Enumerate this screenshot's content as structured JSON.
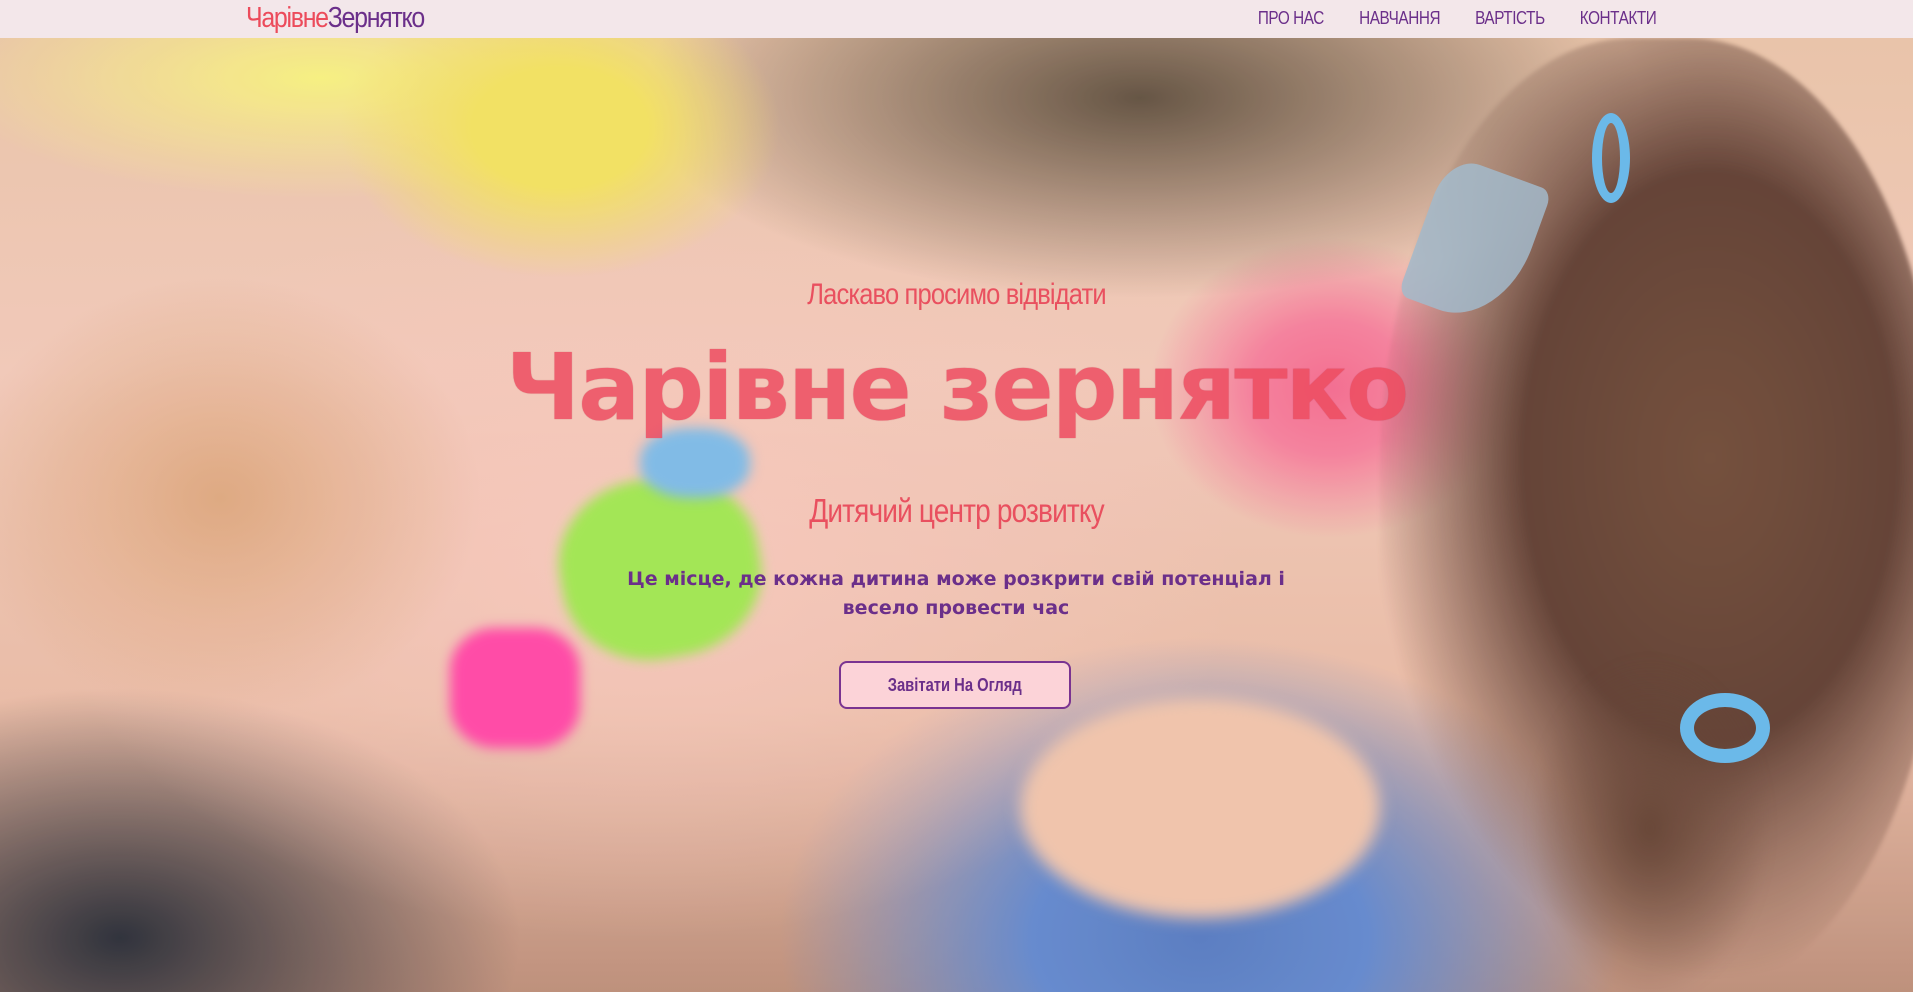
{
  "brand": {
    "part1": "Чарівне",
    "part2": "Зернятко"
  },
  "nav": {
    "items": [
      {
        "label": "ПРО НАС"
      },
      {
        "label": "НАВЧАННЯ"
      },
      {
        "label": "ВАРТІСТЬ"
      },
      {
        "label": "КОНТАКТИ"
      }
    ]
  },
  "hero": {
    "welcome": "Ласкаво просимо відвідати",
    "title": "Чарівне зернятко",
    "subtitle": "Дитячий центр розвитку",
    "description": "Це місце, де кожна дитина може розкрити свій потенціал і весело провести час",
    "cta_label": "Завітати На Огляд"
  },
  "colors": {
    "accent_pink": "#ec4b5b",
    "accent_purple": "#6b2f8a",
    "nav_background": "#f3e7ea",
    "button_background": "#fcd3d8"
  }
}
